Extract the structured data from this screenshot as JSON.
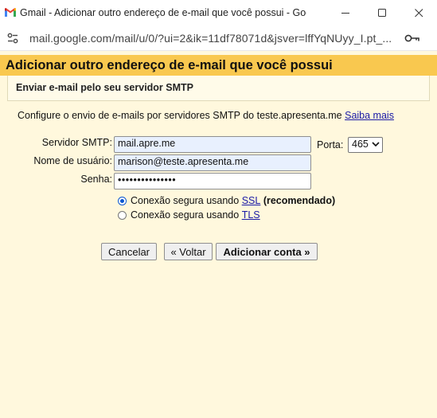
{
  "window": {
    "title": "Gmail - Adicionar outro endereço de e-mail que você possui - Google Chrome"
  },
  "addressbar": {
    "url": "mail.google.com/mail/u/0/?ui=2&ik=11df78071d&jsver=lffYqNUyy_I.pt_..."
  },
  "page": {
    "header": "Adicionar outro endereço de e-mail que você possui",
    "section_title": "Enviar e-mail pelo seu servidor SMTP",
    "intro": "Configure o envio de e-mails por servidores SMTP do teste.apresenta.me",
    "learn_more": "Saiba mais"
  },
  "form": {
    "smtp_label": "Servidor SMTP:",
    "smtp_value": "mail.apre.me",
    "port_label": "Porta:",
    "port_value": "465",
    "user_label": "Nome de usuário:",
    "user_value": "marison@teste.apresenta.me",
    "password_label": "Senha:",
    "password_value": "•••••••••••••••",
    "ssl_prefix": "Conexão segura usando",
    "ssl_link": "SSL",
    "ssl_suffix": "(recomendado)",
    "tls_prefix": "Conexão segura usando",
    "tls_link": "TLS",
    "selected_security": "SSL"
  },
  "buttons": {
    "cancel": "Cancelar",
    "back": "« Voltar",
    "add_account": "Adicionar conta »"
  },
  "colors": {
    "header_bg": "#f9c84f",
    "content_bg": "#fff8dd",
    "autofill_bg": "#e8f0fe",
    "link": "#1a1aa6"
  }
}
